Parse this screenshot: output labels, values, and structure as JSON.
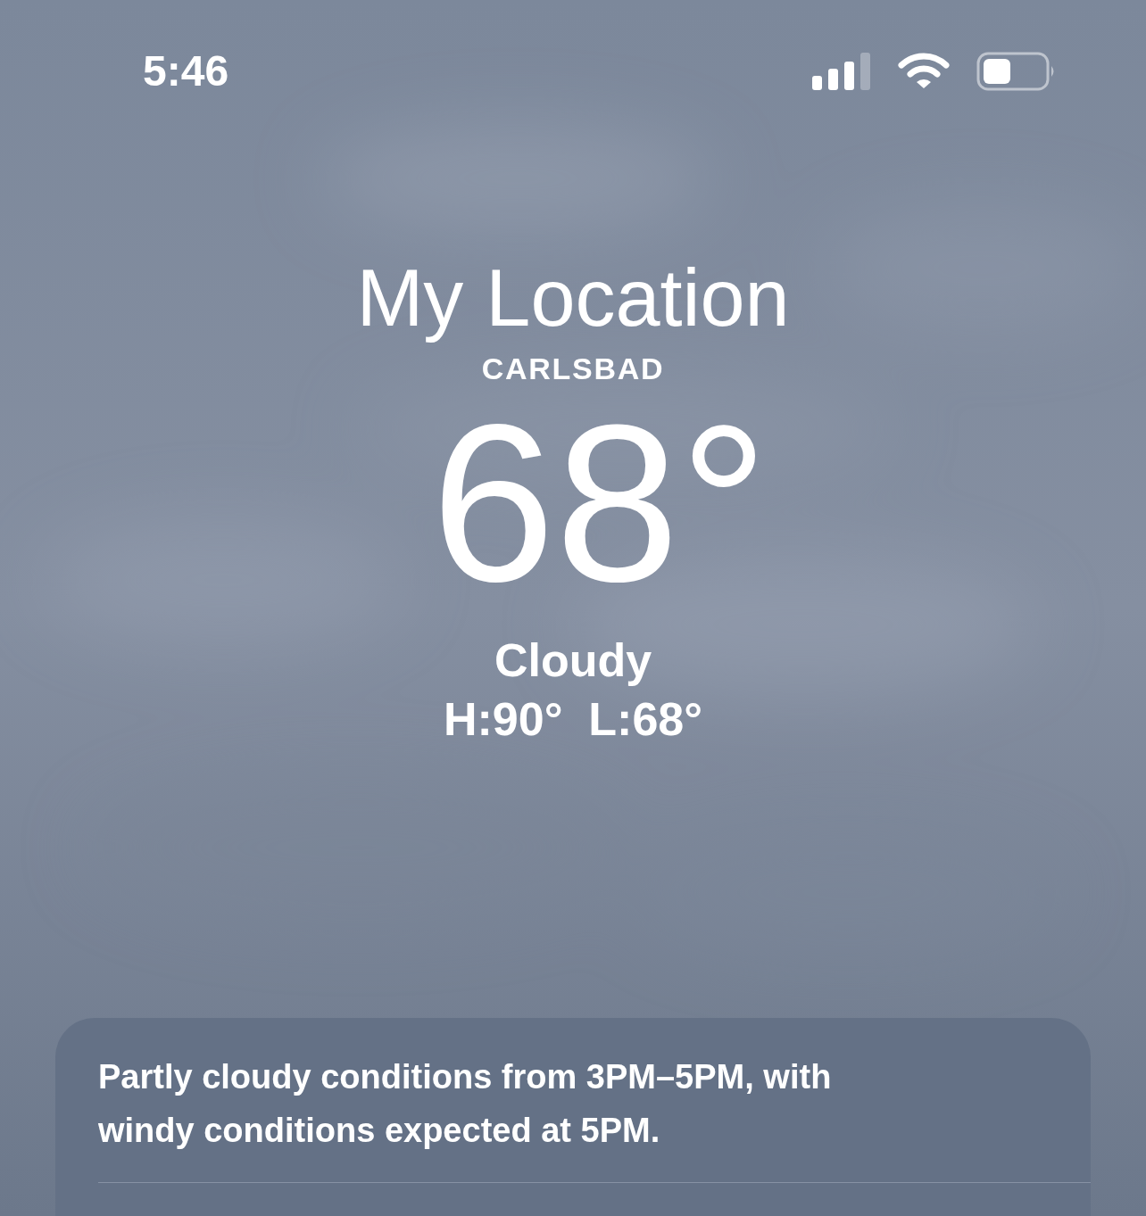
{
  "status_bar": {
    "time": "5:46"
  },
  "location": {
    "title": "My Location",
    "city": "CARLSBAD"
  },
  "current": {
    "temperature": "68°",
    "condition": "Cloudy",
    "high_low": "H:90°  L:68°"
  },
  "summary_card": {
    "text": "Partly cloudy conditions from 3PM–5PM, with windy conditions expected at 5PM."
  }
}
